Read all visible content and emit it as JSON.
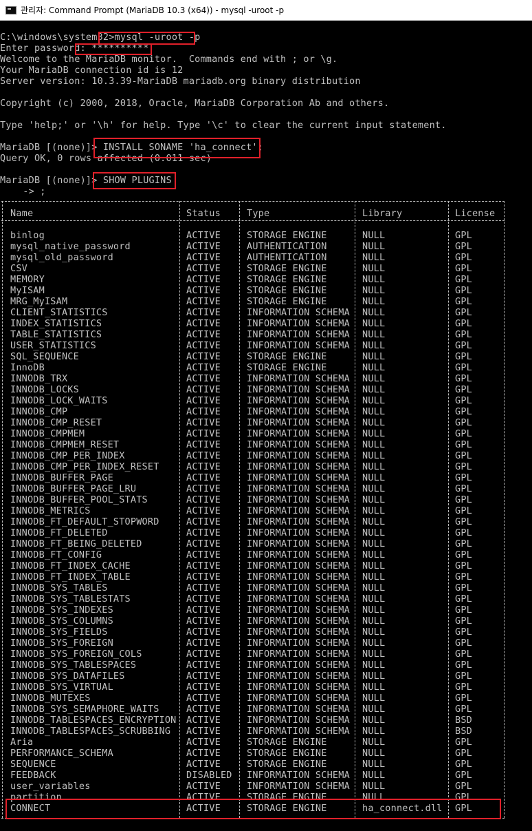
{
  "window": {
    "title": "관리자: Command Prompt (MariaDB 10.3 (x64)) - mysql  -uroot -p"
  },
  "session": {
    "prompt_line": "C:\\windows\\system32>mysql -uroot -p",
    "password_line": "Enter password: **********",
    "welcome_line": "Welcome to the MariaDB monitor.  Commands end with ; or \\g.",
    "connection_line": "Your MariaDB connection id is 12",
    "server_line": "Server version: 10.3.39-MariaDB mariadb.org binary distribution",
    "copyright_line": "Copyright (c) 2000, 2018, Oracle, MariaDB Corporation Ab and others.",
    "help_line": "Type 'help;' or '\\h' for help. Type '\\c' to clear the current input statement.",
    "install_prompt": "MariaDB [(none)]> ",
    "install_cmd": "INSTALL SONAME 'ha_connect';",
    "install_result": "Query OK, 0 rows affected (0.011 sec)",
    "show_prompt": "MariaDB [(none)]> ",
    "show_cmd": "SHOW PLUGINS",
    "continuation": "    -> ;"
  },
  "table": {
    "headers": [
      "Name",
      "Status",
      "Type",
      "Library",
      "License"
    ],
    "rows": [
      [
        "binlog",
        "ACTIVE",
        "STORAGE ENGINE",
        "NULL",
        "GPL"
      ],
      [
        "mysql_native_password",
        "ACTIVE",
        "AUTHENTICATION",
        "NULL",
        "GPL"
      ],
      [
        "mysql_old_password",
        "ACTIVE",
        "AUTHENTICATION",
        "NULL",
        "GPL"
      ],
      [
        "CSV",
        "ACTIVE",
        "STORAGE ENGINE",
        "NULL",
        "GPL"
      ],
      [
        "MEMORY",
        "ACTIVE",
        "STORAGE ENGINE",
        "NULL",
        "GPL"
      ],
      [
        "MyISAM",
        "ACTIVE",
        "STORAGE ENGINE",
        "NULL",
        "GPL"
      ],
      [
        "MRG_MyISAM",
        "ACTIVE",
        "STORAGE ENGINE",
        "NULL",
        "GPL"
      ],
      [
        "CLIENT_STATISTICS",
        "ACTIVE",
        "INFORMATION SCHEMA",
        "NULL",
        "GPL"
      ],
      [
        "INDEX_STATISTICS",
        "ACTIVE",
        "INFORMATION SCHEMA",
        "NULL",
        "GPL"
      ],
      [
        "TABLE_STATISTICS",
        "ACTIVE",
        "INFORMATION SCHEMA",
        "NULL",
        "GPL"
      ],
      [
        "USER_STATISTICS",
        "ACTIVE",
        "INFORMATION SCHEMA",
        "NULL",
        "GPL"
      ],
      [
        "SQL_SEQUENCE",
        "ACTIVE",
        "STORAGE ENGINE",
        "NULL",
        "GPL"
      ],
      [
        "InnoDB",
        "ACTIVE",
        "STORAGE ENGINE",
        "NULL",
        "GPL"
      ],
      [
        "INNODB_TRX",
        "ACTIVE",
        "INFORMATION SCHEMA",
        "NULL",
        "GPL"
      ],
      [
        "INNODB_LOCKS",
        "ACTIVE",
        "INFORMATION SCHEMA",
        "NULL",
        "GPL"
      ],
      [
        "INNODB_LOCK_WAITS",
        "ACTIVE",
        "INFORMATION SCHEMA",
        "NULL",
        "GPL"
      ],
      [
        "INNODB_CMP",
        "ACTIVE",
        "INFORMATION SCHEMA",
        "NULL",
        "GPL"
      ],
      [
        "INNODB_CMP_RESET",
        "ACTIVE",
        "INFORMATION SCHEMA",
        "NULL",
        "GPL"
      ],
      [
        "INNODB_CMPMEM",
        "ACTIVE",
        "INFORMATION SCHEMA",
        "NULL",
        "GPL"
      ],
      [
        "INNODB_CMPMEM_RESET",
        "ACTIVE",
        "INFORMATION SCHEMA",
        "NULL",
        "GPL"
      ],
      [
        "INNODB_CMP_PER_INDEX",
        "ACTIVE",
        "INFORMATION SCHEMA",
        "NULL",
        "GPL"
      ],
      [
        "INNODB_CMP_PER_INDEX_RESET",
        "ACTIVE",
        "INFORMATION SCHEMA",
        "NULL",
        "GPL"
      ],
      [
        "INNODB_BUFFER_PAGE",
        "ACTIVE",
        "INFORMATION SCHEMA",
        "NULL",
        "GPL"
      ],
      [
        "INNODB_BUFFER_PAGE_LRU",
        "ACTIVE",
        "INFORMATION SCHEMA",
        "NULL",
        "GPL"
      ],
      [
        "INNODB_BUFFER_POOL_STATS",
        "ACTIVE",
        "INFORMATION SCHEMA",
        "NULL",
        "GPL"
      ],
      [
        "INNODB_METRICS",
        "ACTIVE",
        "INFORMATION SCHEMA",
        "NULL",
        "GPL"
      ],
      [
        "INNODB_FT_DEFAULT_STOPWORD",
        "ACTIVE",
        "INFORMATION SCHEMA",
        "NULL",
        "GPL"
      ],
      [
        "INNODB_FT_DELETED",
        "ACTIVE",
        "INFORMATION SCHEMA",
        "NULL",
        "GPL"
      ],
      [
        "INNODB_FT_BEING_DELETED",
        "ACTIVE",
        "INFORMATION SCHEMA",
        "NULL",
        "GPL"
      ],
      [
        "INNODB_FT_CONFIG",
        "ACTIVE",
        "INFORMATION SCHEMA",
        "NULL",
        "GPL"
      ],
      [
        "INNODB_FT_INDEX_CACHE",
        "ACTIVE",
        "INFORMATION SCHEMA",
        "NULL",
        "GPL"
      ],
      [
        "INNODB_FT_INDEX_TABLE",
        "ACTIVE",
        "INFORMATION SCHEMA",
        "NULL",
        "GPL"
      ],
      [
        "INNODB_SYS_TABLES",
        "ACTIVE",
        "INFORMATION SCHEMA",
        "NULL",
        "GPL"
      ],
      [
        "INNODB_SYS_TABLESTATS",
        "ACTIVE",
        "INFORMATION SCHEMA",
        "NULL",
        "GPL"
      ],
      [
        "INNODB_SYS_INDEXES",
        "ACTIVE",
        "INFORMATION SCHEMA",
        "NULL",
        "GPL"
      ],
      [
        "INNODB_SYS_COLUMNS",
        "ACTIVE",
        "INFORMATION SCHEMA",
        "NULL",
        "GPL"
      ],
      [
        "INNODB_SYS_FIELDS",
        "ACTIVE",
        "INFORMATION SCHEMA",
        "NULL",
        "GPL"
      ],
      [
        "INNODB_SYS_FOREIGN",
        "ACTIVE",
        "INFORMATION SCHEMA",
        "NULL",
        "GPL"
      ],
      [
        "INNODB_SYS_FOREIGN_COLS",
        "ACTIVE",
        "INFORMATION SCHEMA",
        "NULL",
        "GPL"
      ],
      [
        "INNODB_SYS_TABLESPACES",
        "ACTIVE",
        "INFORMATION SCHEMA",
        "NULL",
        "GPL"
      ],
      [
        "INNODB_SYS_DATAFILES",
        "ACTIVE",
        "INFORMATION SCHEMA",
        "NULL",
        "GPL"
      ],
      [
        "INNODB_SYS_VIRTUAL",
        "ACTIVE",
        "INFORMATION SCHEMA",
        "NULL",
        "GPL"
      ],
      [
        "INNODB_MUTEXES",
        "ACTIVE",
        "INFORMATION SCHEMA",
        "NULL",
        "GPL"
      ],
      [
        "INNODB_SYS_SEMAPHORE_WAITS",
        "ACTIVE",
        "INFORMATION SCHEMA",
        "NULL",
        "GPL"
      ],
      [
        "INNODB_TABLESPACES_ENCRYPTION",
        "ACTIVE",
        "INFORMATION SCHEMA",
        "NULL",
        "BSD"
      ],
      [
        "INNODB_TABLESPACES_SCRUBBING",
        "ACTIVE",
        "INFORMATION SCHEMA",
        "NULL",
        "BSD"
      ],
      [
        "Aria",
        "ACTIVE",
        "STORAGE ENGINE",
        "NULL",
        "GPL"
      ],
      [
        "PERFORMANCE_SCHEMA",
        "ACTIVE",
        "STORAGE ENGINE",
        "NULL",
        "GPL"
      ],
      [
        "SEQUENCE",
        "ACTIVE",
        "STORAGE ENGINE",
        "NULL",
        "GPL"
      ],
      [
        "FEEDBACK",
        "DISABLED",
        "INFORMATION SCHEMA",
        "NULL",
        "GPL"
      ],
      [
        "user_variables",
        "ACTIVE",
        "INFORMATION SCHEMA",
        "NULL",
        "GPL"
      ],
      [
        "partition",
        "ACTIVE",
        "STORAGE ENGINE",
        "NULL",
        "GPL"
      ],
      [
        "CONNECT",
        "ACTIVE",
        "STORAGE ENGINE",
        "ha_connect.dll",
        "GPL"
      ]
    ]
  },
  "colors": {
    "console_bg": "#000000",
    "console_text": "#c0c0c0",
    "highlight": "#e0202a"
  }
}
